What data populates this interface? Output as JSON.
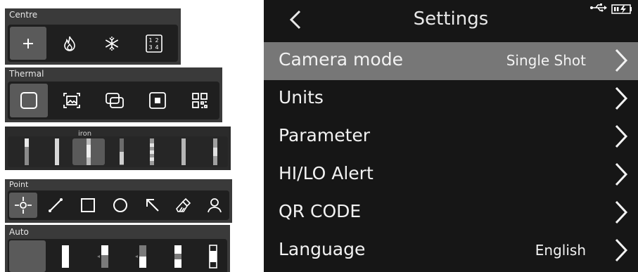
{
  "left_panels": {
    "centre": {
      "label": "Centre",
      "tools": [
        "add-icon",
        "flame-icon",
        "snowflake-icon",
        "grid-numbers-icon"
      ],
      "grid_digits": [
        "1",
        "2",
        "3",
        "4"
      ]
    },
    "thermal": {
      "label": "Thermal",
      "tools": [
        "square-icon",
        "picture-in-picture-icon",
        "overlap-icon",
        "framed-square-icon",
        "qr-icon"
      ]
    },
    "palette": {
      "name": "iron"
    },
    "point": {
      "label": "Point",
      "tools": [
        "crosshair-icon",
        "line-icon",
        "rectangle-icon",
        "circle-icon",
        "arrow-icon",
        "eraser-icon",
        "person-icon"
      ]
    },
    "auto": {
      "label": "Auto"
    }
  },
  "settings": {
    "title": "Settings",
    "items": [
      {
        "label": "Camera mode",
        "value": "Single Shot",
        "selected": true
      },
      {
        "label": "Units",
        "value": ""
      },
      {
        "label": "Parameter",
        "value": ""
      },
      {
        "label": "HI/LO Alert",
        "value": ""
      },
      {
        "label": "QR CODE",
        "value": ""
      },
      {
        "label": "Language",
        "value": "English"
      }
    ]
  },
  "colors": {
    "selected_row": "#777777",
    "screen_bg": "#161616",
    "panel_bg": "#3a3a3a"
  }
}
